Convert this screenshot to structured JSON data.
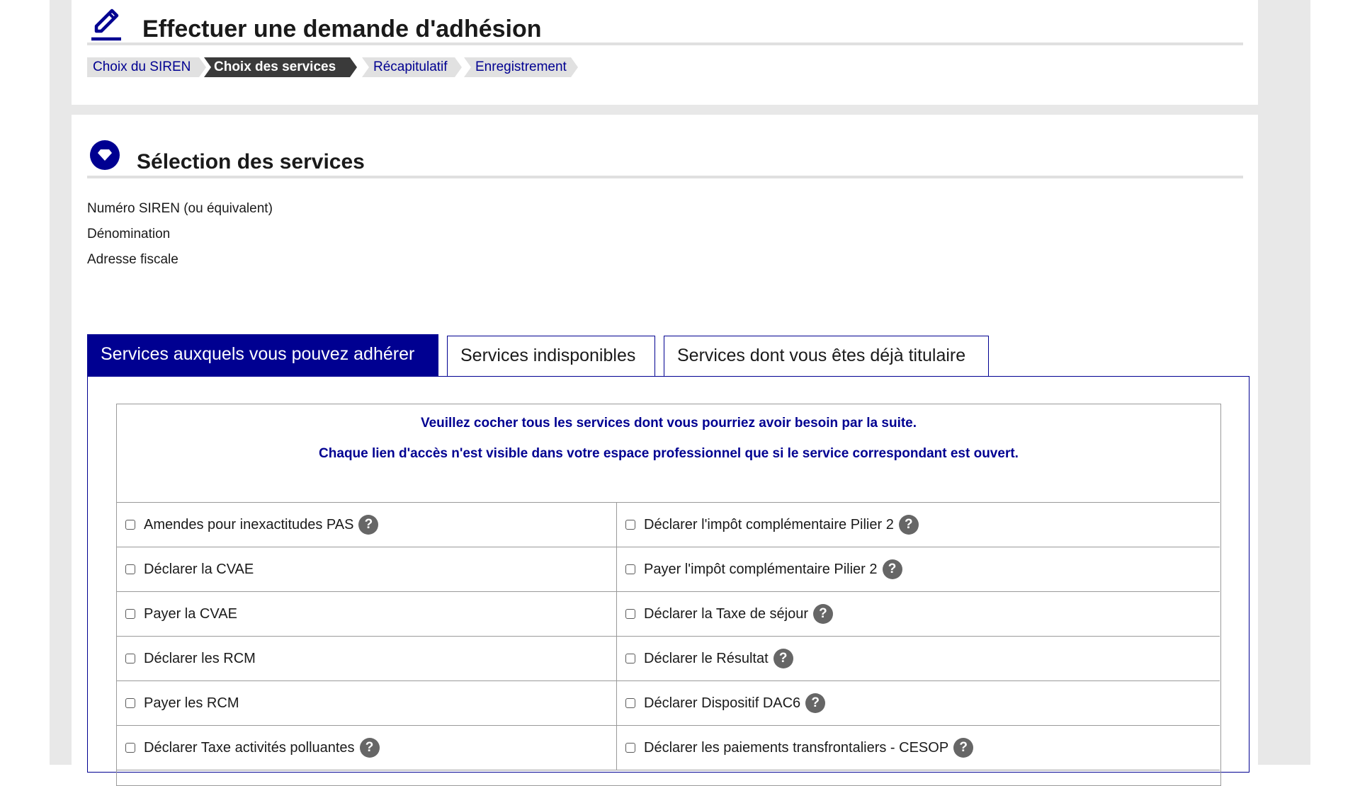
{
  "header": {
    "title": "Effectuer une demande d'adhésion",
    "steps": [
      {
        "label": "Choix du SIREN",
        "active": false
      },
      {
        "label": "Choix des services",
        "active": true
      },
      {
        "label": "Récapitulatif",
        "active": false
      },
      {
        "label": "Enregistrement",
        "active": false
      }
    ]
  },
  "section": {
    "title": "Sélection des services",
    "fields": [
      "Numéro SIREN (ou équivalent)",
      "Dénomination",
      "Adresse fiscale"
    ]
  },
  "tabs": [
    {
      "label": "Services auxquels vous pouvez adhérer",
      "active": true
    },
    {
      "label": "Services indisponibles",
      "active": false
    },
    {
      "label": "Services dont vous êtes déjà titulaire",
      "active": false
    }
  ],
  "notice": {
    "line1": "Veuillez cocher tous les services dont vous pourriez avoir besoin par la suite.",
    "line2": "Chaque lien d'accès n'est visible dans votre espace professionnel que si le service correspondant est ouvert."
  },
  "services": {
    "left": [
      {
        "label": "Amendes pour inexactitudes PAS",
        "help": true,
        "checked": false
      },
      {
        "label": "Déclarer la CVAE",
        "help": false,
        "checked": false
      },
      {
        "label": "Payer la CVAE",
        "help": false,
        "checked": false
      },
      {
        "label": "Déclarer les RCM",
        "help": false,
        "checked": false
      },
      {
        "label": "Payer les RCM",
        "help": false,
        "checked": false
      },
      {
        "label": "Déclarer Taxe activités polluantes",
        "help": true,
        "checked": false
      }
    ],
    "right": [
      {
        "label": "Déclarer l'impôt complémentaire Pilier 2",
        "help": true,
        "checked": false
      },
      {
        "label": "Payer l'impôt complémentaire Pilier 2",
        "help": true,
        "checked": false
      },
      {
        "label": "Déclarer la Taxe de séjour",
        "help": true,
        "checked": false
      },
      {
        "label": "Déclarer le Résultat",
        "help": true,
        "checked": false
      },
      {
        "label": "Déclarer Dispositif DAC6",
        "help": true,
        "checked": false
      },
      {
        "label": "Déclarer les paiements transfrontaliers - CESOP",
        "help": true,
        "checked": false
      }
    ],
    "help_glyph": "?"
  },
  "colors": {
    "primary": "#000091",
    "active_step": "#3a3a3a",
    "step_bg": "#e1e1e1",
    "help_bg": "#666666"
  }
}
